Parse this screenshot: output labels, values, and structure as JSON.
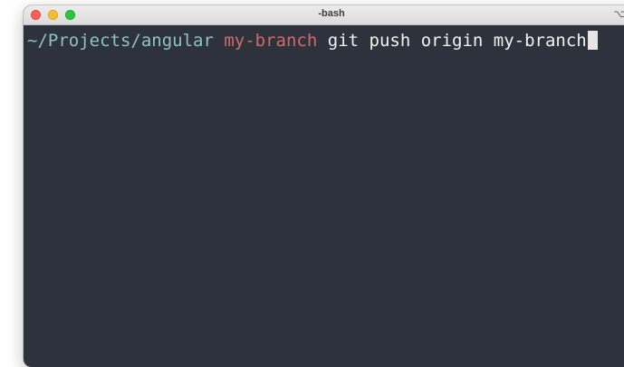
{
  "window": {
    "title": "-bash",
    "shortcut_glyph": "⌥"
  },
  "terminal": {
    "prompt_path": "~/Projects/angular",
    "prompt_branch": "my-branch",
    "command": "git push origin my-branch"
  },
  "colors": {
    "background": "#2e323c",
    "path": "#8ec3c6",
    "branch": "#d36a6a",
    "command": "#f2f2f2"
  },
  "icons": [
    "close-button",
    "minimize-button",
    "zoom-button",
    "option-key-icon",
    "text-cursor"
  ]
}
